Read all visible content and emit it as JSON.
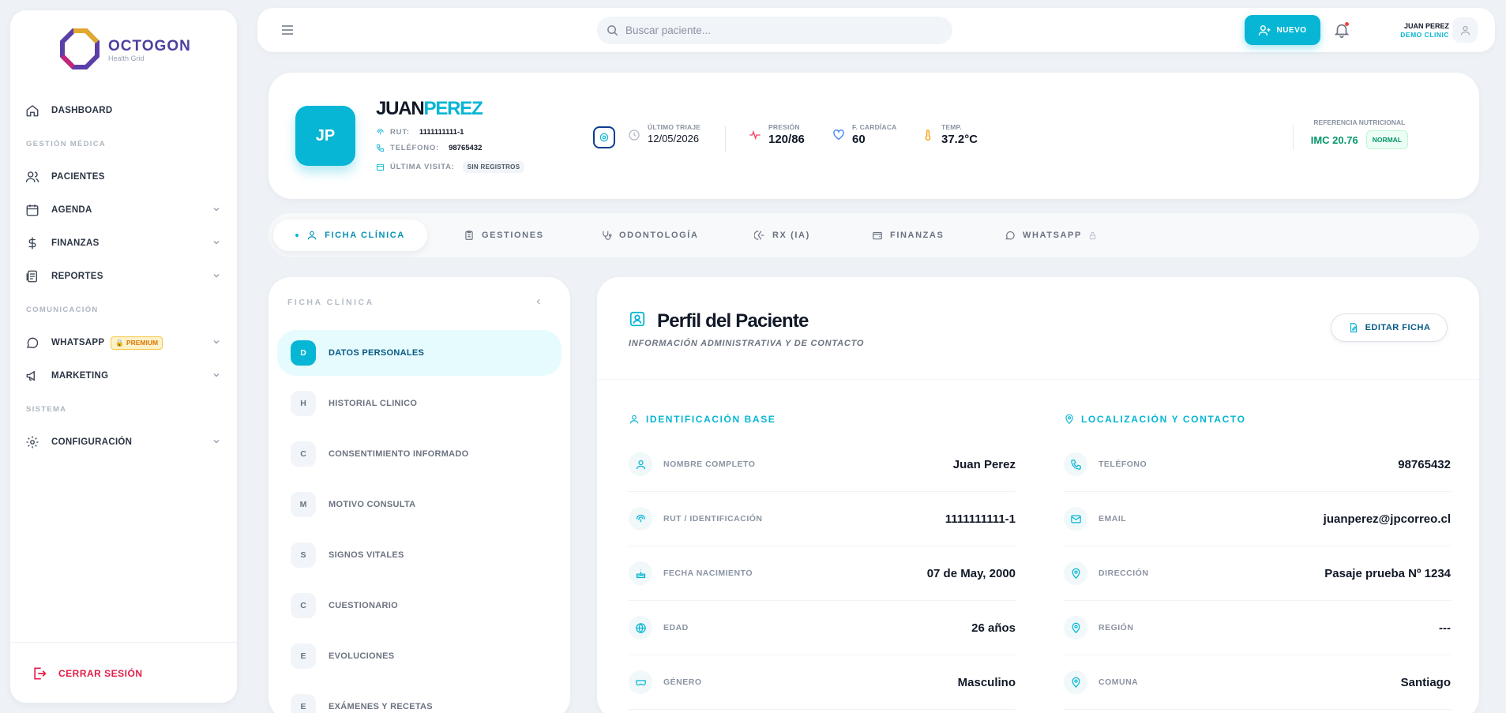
{
  "brand": {
    "name": "OCTOGON",
    "tagline": "Health Grid"
  },
  "sidebar": {
    "items": [
      {
        "label": "DASHBOARD"
      },
      {
        "section": "GESTIÓN MÉDICA"
      },
      {
        "label": "PACIENTES"
      },
      {
        "label": "AGENDA"
      },
      {
        "label": "FINANZAS"
      },
      {
        "label": "REPORTES"
      },
      {
        "section": "COMUNICACIÓN"
      },
      {
        "label": "WHATSAPP",
        "badge": "PREMIUM"
      },
      {
        "label": "MARKETING"
      },
      {
        "section": "SISTEMA"
      },
      {
        "label": "CONFIGURACIÓN"
      }
    ],
    "logout": "CERRAR SESIÓN"
  },
  "topbar": {
    "search_placeholder": "Buscar paciente...",
    "new_button": "NUEVO",
    "user_name": "JUAN PEREZ",
    "user_clinic": "DEMO CLINIC"
  },
  "patient": {
    "initials": "JP",
    "first_name": "JUAN",
    "last_name": "PEREZ",
    "rut_label": "RUT:",
    "rut": "1111111111-1",
    "phone_label": "TELÉFONO:",
    "phone": "98765432",
    "last_visit_label": "ÚLTIMA VISITA:",
    "last_visit": "SIN REGISTROS",
    "triage_label": "ÚLTIMO TRIAJE",
    "triage_date": "12/05/2026",
    "pressure_label": "PRESIÓN",
    "pressure": "120/86",
    "heart_label": "F. CARDÍACA",
    "heart": "60",
    "temp_label": "TEMP.",
    "temp": "37.2°C",
    "nutri_label": "REFERENCIA NUTRICIONAL",
    "imc": "IMC 20.76",
    "imc_status": "NORMAL"
  },
  "tabs": [
    "FICHA CLÍNICA",
    "GESTIONES",
    "ODONTOLOGÍA",
    "RX (IA)",
    "FINANZAS",
    "WHATSAPP"
  ],
  "ficha": {
    "title": "FICHA CLÍNICA",
    "items": [
      {
        "letter": "D",
        "label": "DATOS PERSONALES"
      },
      {
        "letter": "H",
        "label": "HISTORIAL CLINICO"
      },
      {
        "letter": "C",
        "label": "CONSENTIMIENTO INFORMADO"
      },
      {
        "letter": "M",
        "label": "MOTIVO CONSULTA"
      },
      {
        "letter": "S",
        "label": "SIGNOS VITALES"
      },
      {
        "letter": "C",
        "label": "CUESTIONARIO"
      },
      {
        "letter": "E",
        "label": "EVOLUCIONES"
      },
      {
        "letter": "E",
        "label": "EXÁMENES Y RECETAS"
      }
    ]
  },
  "profile": {
    "title": "Perfil del Paciente",
    "subtitle": "INFORMACIÓN ADMINISTRATIVA Y DE CONTACTO",
    "edit_button": "EDITAR FICHA",
    "id_section": "IDENTIFICACIÓN BASE",
    "contact_section": "LOCALIZACIÓN Y CONTACTO",
    "id_fields": [
      {
        "label": "NOMBRE COMPLETO",
        "value": "Juan Perez"
      },
      {
        "label": "RUT / IDENTIFICACIÓN",
        "value": "1111111111-1"
      },
      {
        "label": "FECHA NACIMIENTO",
        "value": "07 de May, 2000"
      },
      {
        "label": "EDAD",
        "value": "26 años"
      },
      {
        "label": "GÉNERO",
        "value": "Masculino"
      }
    ],
    "contact_fields": [
      {
        "label": "TELÉFONO",
        "value": "98765432"
      },
      {
        "label": "EMAIL",
        "value": "juanperez@jpcorreo.cl"
      },
      {
        "label": "DIRECCIÓN",
        "value": "Pasaje prueba Nº 1234"
      },
      {
        "label": "REGIÓN",
        "value": "---"
      },
      {
        "label": "COMUNA",
        "value": "Santiago"
      }
    ]
  },
  "colors": {
    "accent": "#06b6d4",
    "brand": "#4c3fa0",
    "danger": "#e11d48",
    "success": "#059669"
  }
}
